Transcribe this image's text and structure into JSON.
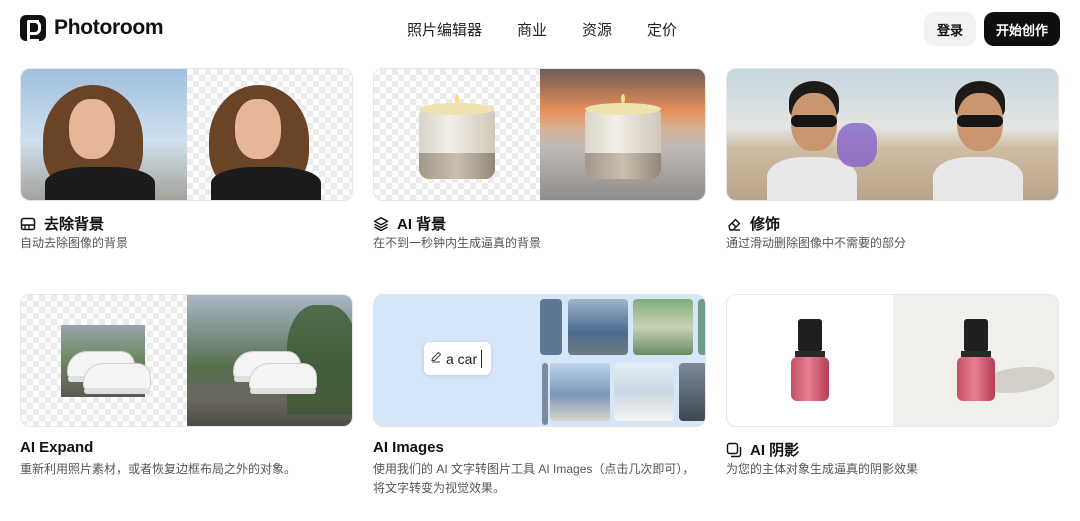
{
  "brand": {
    "name": "Photoroom"
  },
  "nav": [
    {
      "label": "照片编辑器"
    },
    {
      "label": "商业"
    },
    {
      "label": "资源"
    },
    {
      "label": "定价"
    }
  ],
  "actions": {
    "login": "登录",
    "start": "开始创作"
  },
  "cards": [
    {
      "title": "去除背景",
      "desc": "自动去除图像的背景",
      "icon": "cutout-icon"
    },
    {
      "title": "AI 背景",
      "desc": "在不到一秒钟内生成逼真的背景",
      "icon": "layers-icon"
    },
    {
      "title": "修饰",
      "desc": "通过滑动删除图像中不需要的部分",
      "icon": "eraser-icon"
    },
    {
      "title": "AI Expand",
      "desc": "重新利用照片素材，或者恢复边框布局之外的对象。",
      "icon": ""
    },
    {
      "title": "AI Images",
      "desc": "使用我们的 AI 文字转图片工具 AI Images（点击几次即可），将文字转变为视觉效果。",
      "icon": ""
    },
    {
      "title": "AI 阴影",
      "desc": "为您的主体对象生成逼真的阴影效果",
      "icon": "shadow-icon"
    }
  ],
  "prompt": {
    "text": "a car"
  }
}
